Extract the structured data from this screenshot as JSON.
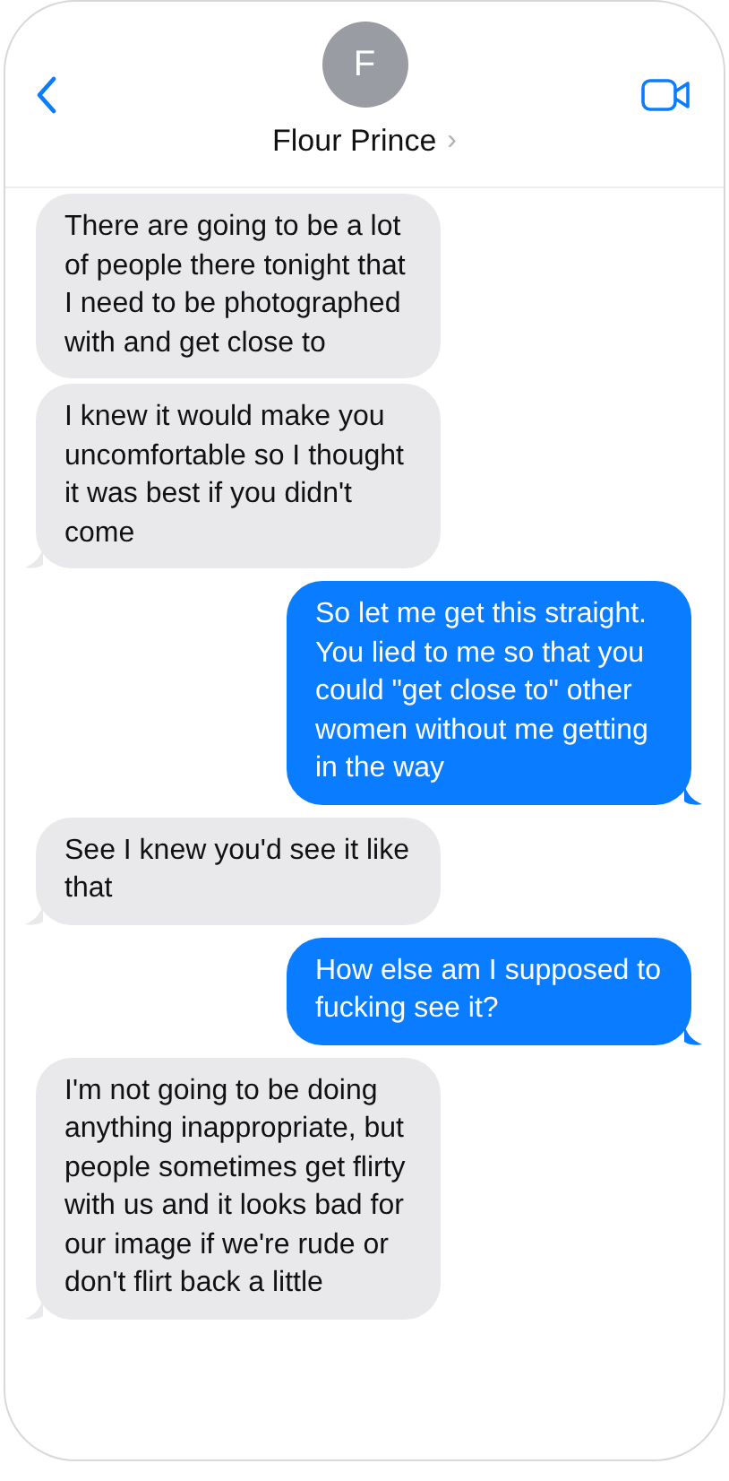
{
  "header": {
    "avatar_initial": "F",
    "contact_name": "Flour Prince",
    "chevron": "›"
  },
  "messages": [
    {
      "kind": "received",
      "text": "There are going to be a lot of people there tonight that I need to be photographed with and get close to",
      "tail": false
    },
    {
      "kind": "received",
      "text": "I knew it would make you uncomfortable so I thought it was best if you didn't come",
      "tail": true
    },
    {
      "kind": "sent",
      "text": "So let me get this straight. You lied to me so that you could \"get close to\" other women without me getting in the way",
      "tail": true
    },
    {
      "kind": "received",
      "text": "See I knew you'd see it like that",
      "tail": true
    },
    {
      "kind": "sent",
      "text": "How else am I supposed to fucking see it?",
      "tail": true
    },
    {
      "kind": "received",
      "text": "I'm not going to be doing anything inappropriate, but people sometimes get flirty with us and it looks bad for our image if we're rude or don't flirt back a little",
      "tail": true
    }
  ]
}
